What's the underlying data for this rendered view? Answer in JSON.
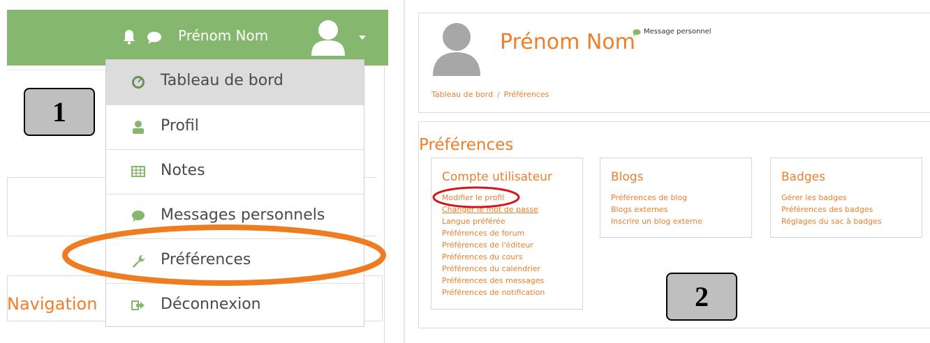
{
  "left": {
    "topbar": {
      "user_name": "Prénom Nom",
      "bg_color": "#86b76f",
      "icons": [
        "bell-icon",
        "chat-icon",
        "user-avatar-icon",
        "caret-down-icon"
      ]
    },
    "menu": {
      "items": [
        {
          "label": "Tableau de bord",
          "icon": "dashboard-icon"
        },
        {
          "label": "Profil",
          "icon": "user-icon"
        },
        {
          "label": "Notes",
          "icon": "grid-table-icon"
        },
        {
          "label": "Messages personnels",
          "icon": "chat-icon"
        },
        {
          "label": "Préférences",
          "icon": "wrench-icon"
        },
        {
          "label": "Déconnexion",
          "icon": "logout-icon"
        }
      ]
    },
    "navigation_label": "Navigation",
    "step_number": "1"
  },
  "right": {
    "header": {
      "full_name": "Prénom Nom",
      "message_label": "Message personnel",
      "breadcrumb": [
        "Tableau de bord",
        "Préférences"
      ]
    },
    "preferences": {
      "title": "Préférences",
      "sections": [
        {
          "title": "Compte utilisateur",
          "links": [
            "Modifier le profil",
            "Changer le mot de passe",
            "Langue préférée",
            "Préférences de forum",
            "Préférences de l'éditeur",
            "Préférences du cours",
            "Préférences du calendrier",
            "Préférences des messages",
            "Préférences de notification"
          ]
        },
        {
          "title": "Blogs",
          "links": [
            "Préférences de blog",
            "Blogs externes",
            "Inscrire un blog externe"
          ]
        },
        {
          "title": "Badges",
          "links": [
            "Gérer les badges",
            "Préférences des badges",
            "Réglages du sac à badges"
          ]
        }
      ]
    },
    "step_number": "2"
  },
  "colors": {
    "accent_orange": "#ef7d2a",
    "highlight_orange": "#f07c22",
    "highlight_red": "#d6141c",
    "step_box_gray": "#bfbfbf"
  }
}
